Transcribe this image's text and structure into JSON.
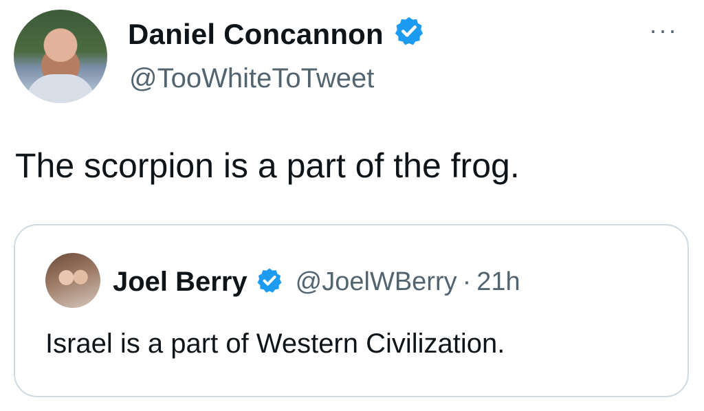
{
  "tweet": {
    "author_name": "Daniel Concannon",
    "author_handle": "@TooWhiteToTweet",
    "more_label": "···",
    "text": "The scorpion is a part of the frog."
  },
  "quoted_tweet": {
    "author_name": "Joel Berry",
    "author_handle": "@JoelWBerry",
    "separator": "·",
    "time": "21h",
    "text": "Israel is a part of Western Civilization."
  },
  "icons": {
    "verified": "verified-badge-icon",
    "more": "more-options-icon"
  },
  "colors": {
    "verified_blue": "#1d9bf0",
    "secondary_text": "#536471",
    "border": "#cfd9de"
  }
}
